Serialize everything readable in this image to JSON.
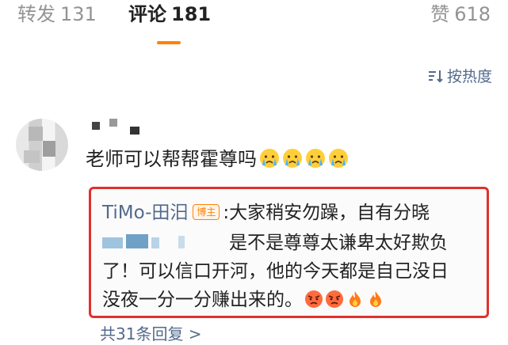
{
  "tabs": {
    "repost": {
      "label": "转发",
      "count": "131"
    },
    "comments": {
      "label": "评论",
      "count": "181"
    },
    "likes": {
      "label": "赞",
      "count": "618"
    }
  },
  "sort": {
    "label": "按热度"
  },
  "comment": {
    "text": "老师可以帮帮霍尊吗",
    "emojis": [
      "crying-emoji",
      "crying-emoji",
      "crying-emoji",
      "crying-emoji"
    ]
  },
  "reply": {
    "author": "TiMo-田汨",
    "badge": "博主",
    "line1": ":大家稍安勿躁，自有分晓",
    "line2": "是不是尊尊太谦卑太好欺负",
    "line3": "了！可以信口开河，他的今天都是自己没日",
    "line4": "没夜一分一分赚出来的。",
    "emojis": [
      "angry-emoji",
      "angry-emoji",
      "fire-emoji",
      "fire-emoji"
    ]
  },
  "more_replies": "共31条回复 >",
  "colors": {
    "accent": "#ff8200",
    "link": "#536a8c",
    "highlight_border": "#e0312b"
  }
}
